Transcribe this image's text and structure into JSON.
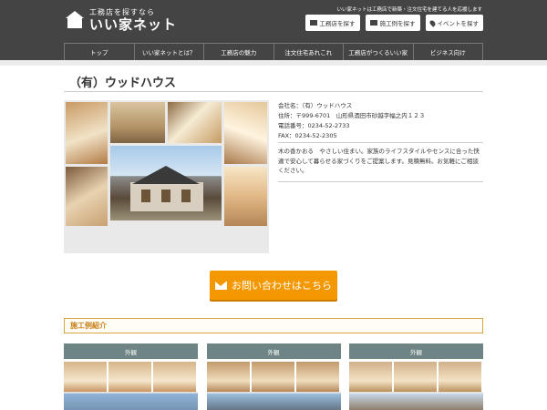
{
  "header": {
    "logo_sub": "工務店を探すなら",
    "logo_main": "いい家ネット",
    "tagline": "いい家ネットは工務店で新築・注文住宅を建てる人を応援します",
    "buttons": [
      {
        "label": "工務店を探す",
        "icon": "building-icon"
      },
      {
        "label": "施工例を探す",
        "icon": "image-icon"
      },
      {
        "label": "イベントを探す",
        "icon": "map-pin-icon"
      }
    ]
  },
  "nav": {
    "items": [
      "トップ",
      "いい家ネットとは？",
      "工務店の魅力",
      "注文住宅あれこれ",
      "工務店がつくるいい家",
      "ビジネス向け"
    ]
  },
  "company": {
    "title": "（有）ウッドハウス",
    "name": "会社名：（有）ウッドハウス",
    "address": "住所：〒999-6701　山形県酒田市砂越字幅之内１２３",
    "phone": "電話番号：0234-52-2733",
    "fax": "FAX：0234-52-2305",
    "description": "木の香かおる　やさしい住まい。家族のライフスタイルやセンスに合った快適で安心して暮らせる家づくりをご提案します。見積無料。お気軽にご相談ください。"
  },
  "contact": {
    "label": "お問い合わせはこちら",
    "icon": "mail-icon"
  },
  "works": {
    "section_title": "施工例紹介",
    "cards": [
      {
        "label": "外観"
      },
      {
        "label": "外観"
      },
      {
        "label": "外観"
      }
    ]
  }
}
